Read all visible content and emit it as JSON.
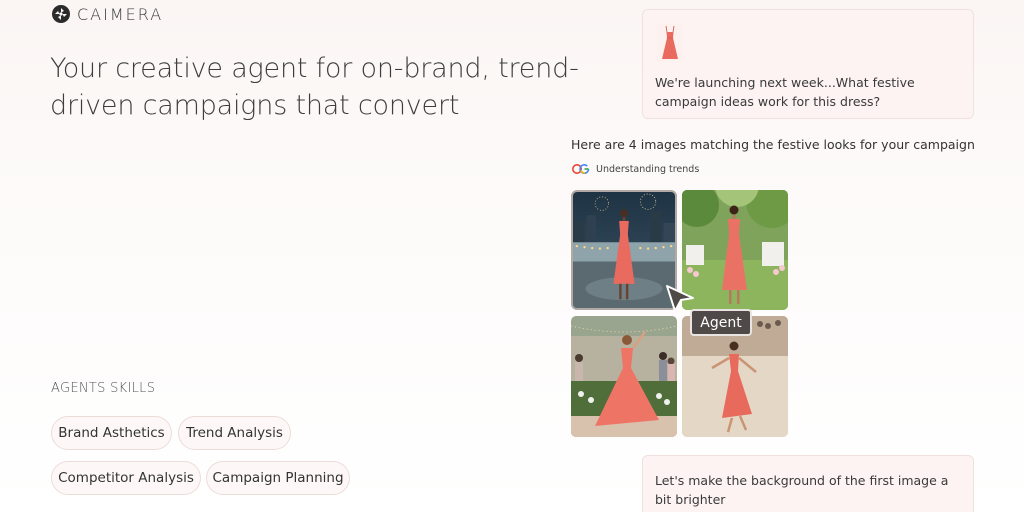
{
  "brand": {
    "name": "CAIMERA"
  },
  "hero": {
    "title": "Your creative agent for on-brand, trend-driven campaigns that convert"
  },
  "skills": {
    "heading": "AGENTS SKILLS",
    "items": [
      "Brand Asthetics",
      "Trend Analysis",
      "Competitor Analysis",
      "Campaign Planning"
    ]
  },
  "chat": {
    "user_message_1": "We're launching next week...What festive campaign ideas work for this dress?",
    "agent_response": "Here are 4 images matching the festive looks for your campaign",
    "status_label": "Understanding trends",
    "user_message_2": "Let's make the background of the first image a bit brighter",
    "cursor_label": "Agent"
  },
  "colors": {
    "dress": "#e96a5e",
    "accent_dark": "#4f4a48",
    "bubble_bg": "#fcf3f2"
  }
}
